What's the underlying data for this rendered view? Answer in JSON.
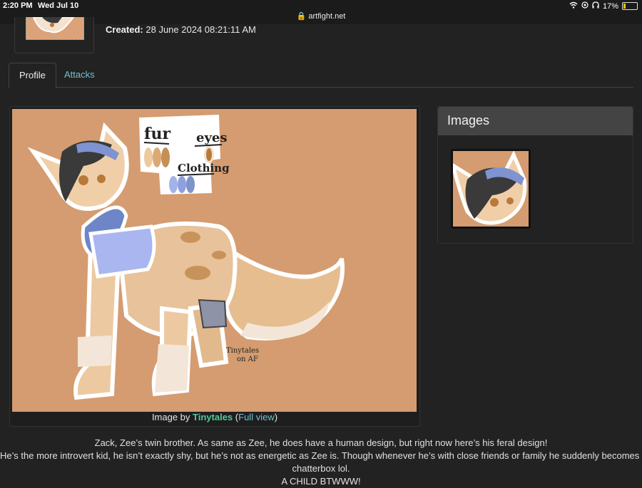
{
  "status_bar": {
    "time": "2:20 PM",
    "date": "Wed Jul 10",
    "url": "artfight.net",
    "battery": "17%",
    "battery_level": 0.17
  },
  "character": {
    "created_label": "Created:",
    "created_value": "28 June 2024 08:21:11 AM"
  },
  "tabs": [
    {
      "label": "Profile",
      "active": true
    },
    {
      "label": "Attacks",
      "active": false
    }
  ],
  "artwork": {
    "palette_labels": {
      "fur": "fur",
      "eyes": "eyes",
      "clothing": "Clothing"
    },
    "signature_line1": "Tinytales",
    "signature_line2": "on AF",
    "caption_prefix": "Image by",
    "artist": "Tinytales",
    "full_view": "Full view"
  },
  "images_panel": {
    "title": "Images"
  },
  "description": [
    "Zack, Zee’s twin brother. As same as Zee, he does have a human design, but right now here’s his feral design!",
    "He’s the more introvert kid, he isn’t exactly shy, but he’s not as energetic as Zee is. Though whenever he’s with close friends or family he suddenly becomes a",
    "chatterbox lol.",
    "A CHILD BTWWW!"
  ],
  "colors": {
    "background": "#222222",
    "link": "#6fc1d0",
    "artist_link": "#54c89a",
    "art_background": "#d49c70",
    "panel_header": "#444444"
  }
}
